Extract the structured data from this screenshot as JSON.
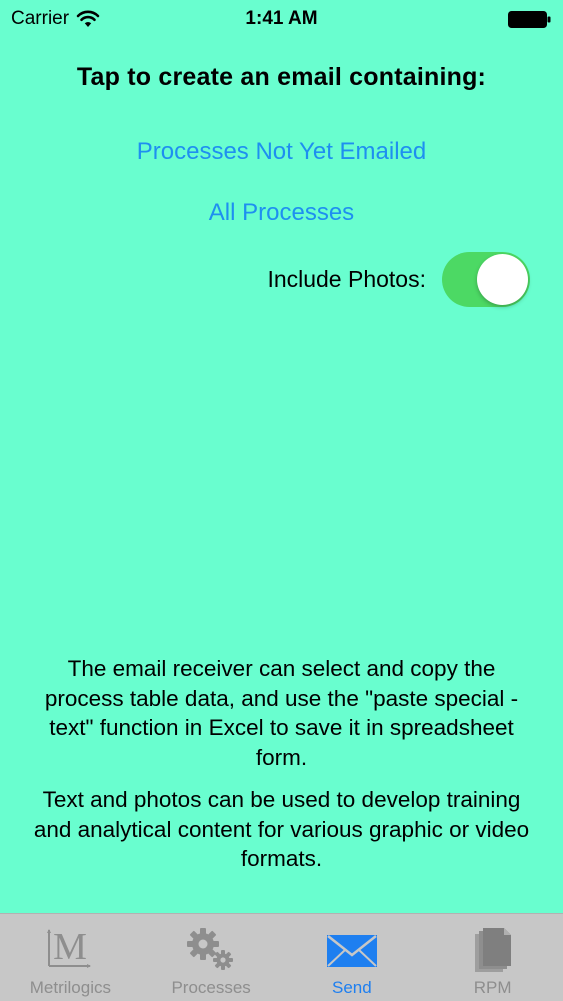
{
  "status_bar": {
    "carrier": "Carrier",
    "time": "1:41 AM"
  },
  "main": {
    "heading": "Tap to create an email containing:",
    "link_not_emailed": "Processes Not Yet Emailed",
    "link_all": "All Processes",
    "photos_label": "Include Photos:",
    "include_photos": true,
    "info_1": "The email receiver can select and copy the process table data, and use the \"paste special - text\" function in Excel to save it in spreadsheet form.",
    "info_2": "Text and photos can be used to develop training and analytical content for various graphic or video formats."
  },
  "tab_bar": {
    "tabs": [
      {
        "label": "Metrilogics",
        "icon": "metrilogics-icon",
        "active": false
      },
      {
        "label": "Processes",
        "icon": "gears-icon",
        "active": false
      },
      {
        "label": "Send",
        "icon": "envelope-icon",
        "active": true
      },
      {
        "label": "RPM",
        "icon": "document-stack-icon",
        "active": false
      }
    ]
  },
  "colors": {
    "background": "#69FECF",
    "link": "#1E8FF0",
    "toggle_on": "#4CD964",
    "tab_bar": "#C7C7C7",
    "tab_active": "#1E7FF0",
    "tab_inactive": "#8E8E8E"
  }
}
